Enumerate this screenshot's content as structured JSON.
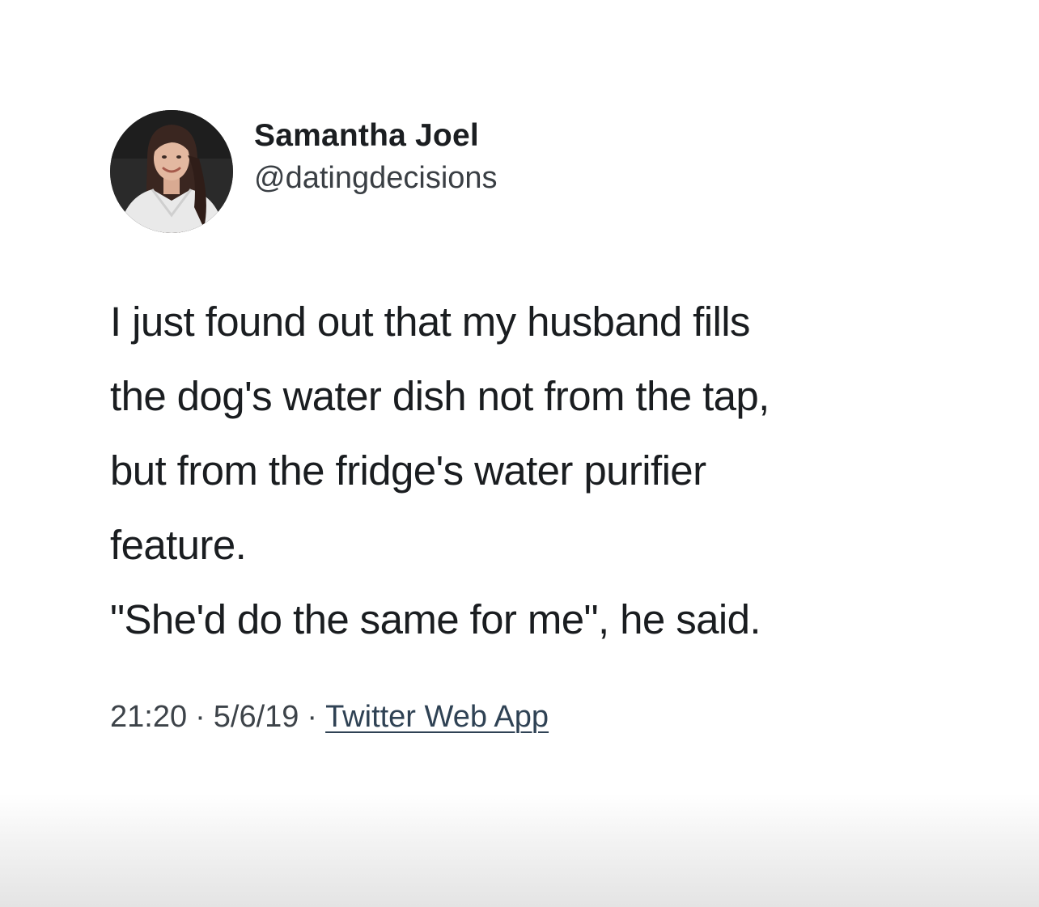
{
  "tweet": {
    "author": {
      "display_name": "Samantha Joel",
      "handle": "@datingdecisions"
    },
    "lines": [
      "I just found out that my husband fills",
      "the dog's water dish not from the tap,",
      "but from the fridge's water purifier",
      "feature."
    ],
    "quote": "\"She'd do the same for me\", he said.",
    "meta": {
      "time": "21:20",
      "separator": "·",
      "date": "5/6/19",
      "source": "Twitter Web App"
    }
  }
}
